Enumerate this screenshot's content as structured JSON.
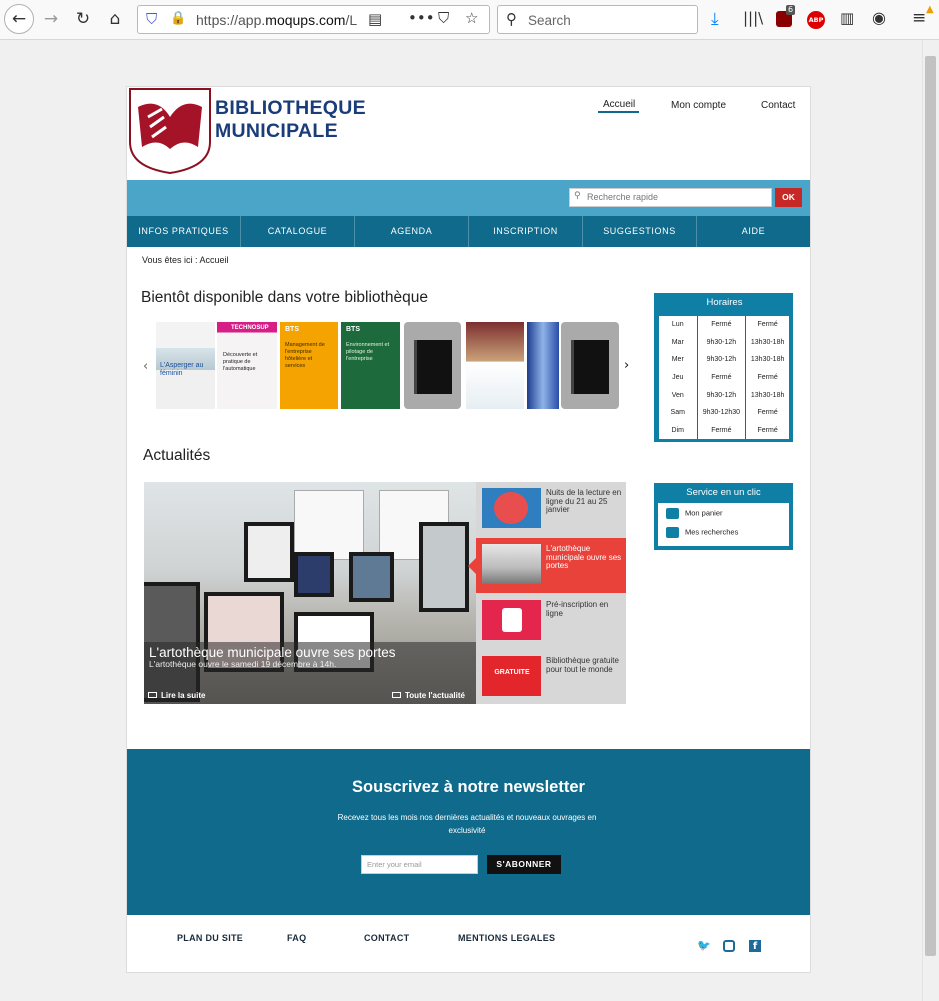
{
  "browser": {
    "url_prefix": "https://app.",
    "url_domain": "moqups.com",
    "url_rest": "/L",
    "search_placeholder": "Search",
    "ublock_badge": "6",
    "abp_label": "ABP"
  },
  "site": {
    "brand_line1": "BIBLIOTHEQUE",
    "brand_line2": "MUNICIPALE",
    "top_links": [
      "Accueil",
      "Mon compte",
      "Contact"
    ],
    "quick_search_placeholder": "Recherche rapide",
    "ok_label": "OK",
    "menu": [
      "INFOS PRATIQUES",
      "CATALOGUE",
      "AGENDA",
      "INSCRIPTION",
      "SUGGESTIONS",
      "AIDE"
    ],
    "breadcrumb": "Vous êtes ici : Accueil"
  },
  "carousel": {
    "title": "Bientôt disponible dans votre bibliothèque",
    "book1_title": "L'Asperger au féminin",
    "book2_header": "TECHNOSUP",
    "book2_title": "Découverte et pratique de l'automatique",
    "book3_title": "Management de l'entreprise hôtelière et services",
    "book4_title": "Environnement et pilotage de l'entreprise",
    "bts_label": "BTS"
  },
  "horaires": {
    "title": "Horaires",
    "rows": [
      [
        "Lun",
        "Fermé",
        "Fermé"
      ],
      [
        "Mar",
        "9h30-12h",
        "13h30-18h"
      ],
      [
        "Mer",
        "9h30-12h",
        "13h30-18h"
      ],
      [
        "Jeu",
        "Fermé",
        "Fermé"
      ],
      [
        "Ven",
        "9h30-12h",
        "13h30-18h"
      ],
      [
        "Sam",
        "9h30-12h30",
        "Fermé"
      ],
      [
        "Dim",
        "Fermé",
        "Fermé"
      ]
    ]
  },
  "news": {
    "title": "Actualités",
    "feature_title": "L'artothèque municipale ouvre ses portes",
    "feature_sub": "L'artothèque ouvre le samedi 19 décembre à 14h.",
    "read_more": "Lire la suite",
    "all_news": "Toute l'actualité",
    "items": [
      "Nuits de la lecture en ligne du 21 au 25 janvier",
      "L'artothèque municipale ouvre ses portes",
      "Pré-inscription en ligne",
      "Bibliothèque gratuite pour tout le monde"
    ],
    "thumb4_text": "GRATUITE"
  },
  "service": {
    "title": "Service en un clic",
    "items": [
      "Mon panier",
      "Mes recherches"
    ]
  },
  "newsletter": {
    "title": "Souscrivez à notre newsletter",
    "desc": "Recevez tous les mois nos dernières actualités et nouveaux ouvrages en exclusivité",
    "email_placeholder": "Enter your email",
    "subscribe": "S'ABONNER"
  },
  "footer": {
    "links": [
      "PLAN DU SITE",
      "FAQ",
      "CONTACT",
      "MENTIONS LEGALES"
    ]
  },
  "colors": {
    "nav": "#0f6a8b",
    "band": "#4aa5c8",
    "accent_red": "#c62828",
    "highlight": "#e8423b"
  }
}
